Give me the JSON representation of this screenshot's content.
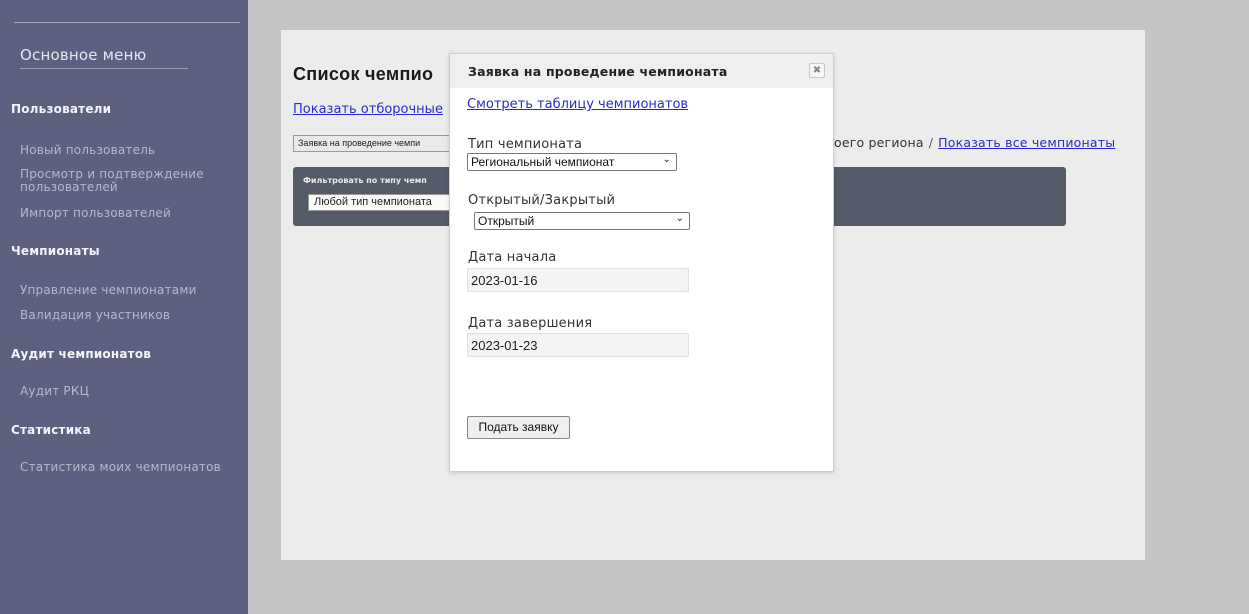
{
  "sidebar": {
    "menu_title": "Основное меню",
    "sections": {
      "users": "Пользователи",
      "championships": "Чемпионаты",
      "audit": "Аудит чемпионатов",
      "stats": "Статистика"
    },
    "items": {
      "new_user": "Новый пользователь",
      "view_confirm_line1": "Просмотр и подтверждение",
      "view_confirm_line2": "пользователей",
      "import_users": "Импорт пользователей",
      "manage_championships": "Управление чемпионатами",
      "validate_participants": "Валидация участников",
      "audit_rkc": "Аудит РКЦ",
      "my_stats": "Статистика моих чемпионатов"
    }
  },
  "page": {
    "title": "Список чемпио",
    "show_qual_link": "Показать отборочные",
    "request_button": "Заявка на проведение чемпи",
    "region_text": "оего региона",
    "separator": "/",
    "show_all_link": "Показать все чемпионаты",
    "filter_label": "Фильтровать по типу чемп",
    "filter_select_value": "Любой тип чемпионата"
  },
  "modal": {
    "title": "Заявка на проведение чемпионата",
    "close_symbol": "✖",
    "view_table_link": "Смотреть таблицу чемпионатов",
    "type_label": "Тип чемпионата",
    "type_value": "Региональный чемпионат",
    "open_closed_label": "Открытый/Закрытый",
    "open_closed_value": "Открытый",
    "start_label": "Дата начала",
    "start_value": "2023-01-16",
    "end_label": "Дата завершения",
    "end_value": "2023-01-23",
    "submit_label": "Подать заявку",
    "chevron_symbol": "⌄"
  }
}
